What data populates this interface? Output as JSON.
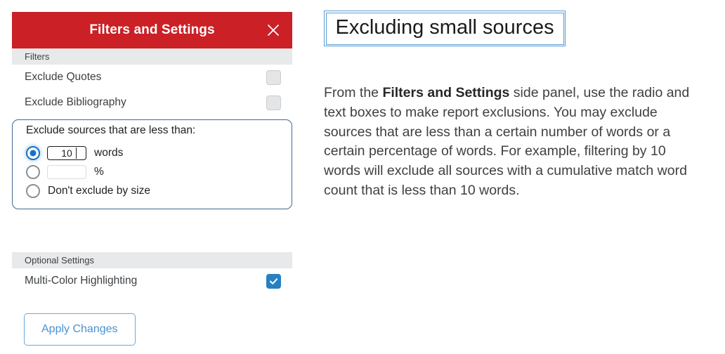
{
  "panel": {
    "title": "Filters and Settings",
    "close_icon": "close-icon",
    "sections": {
      "filters_label": "Filters",
      "optional_label": "Optional Settings"
    },
    "toggles": [
      {
        "label": "Exclude Quotes",
        "checked": false
      },
      {
        "label": "Exclude Bibliography",
        "checked": false
      }
    ],
    "size_group": {
      "label": "Exclude sources that are less than:",
      "options": [
        {
          "id": "words",
          "selected": true,
          "value": "10",
          "unit": "words"
        },
        {
          "id": "percent",
          "selected": false,
          "value": "",
          "unit": "%"
        },
        {
          "id": "none",
          "selected": false,
          "text": "Don't exclude by size"
        }
      ]
    },
    "optional": [
      {
        "label": "Multi-Color Highlighting",
        "checked": true
      }
    ],
    "apply_label": "Apply Changes"
  },
  "content": {
    "heading": "Excluding small sources",
    "paragraph": {
      "before": "From the ",
      "bold": "Filters and Settings",
      "after": " side panel, use the radio and text boxes to make report exclusions. You may exclude sources that are less than a certain number of words or a certain percentage of words. For example, filtering by 10 words will exclude all sources with a cumulative match word count that is less than 10 words."
    }
  },
  "colors": {
    "header_red": "#cb2026",
    "accent_blue": "#2680c2",
    "radio_blue": "#1473c6",
    "group_border": "#41688f",
    "section_gray": "#e8e9ea",
    "heading_border": "#5b9bd5"
  }
}
